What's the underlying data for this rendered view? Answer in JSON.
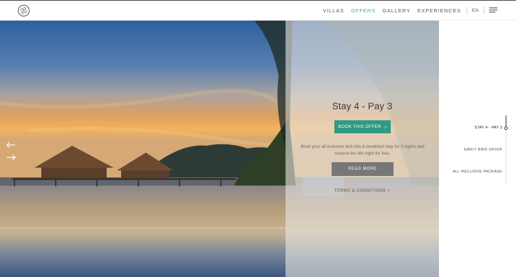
{
  "nav": {
    "items": [
      "VILLAS",
      "OFFERS",
      "GALLERY",
      "EXPERIENCES"
    ],
    "active": "OFFERS",
    "accent": "#3aa99a",
    "language": "EN",
    "logo_icon": "spiral-logo-icon",
    "menu_icon": "hamburger-menu-icon"
  },
  "hero": {
    "prev_icon": "arrow-left-icon",
    "next_icon": "arrow-right-icon"
  },
  "offer": {
    "title": "Stay 4 - Pay 3",
    "book_label": "BOOK THIS OFFER",
    "description": "Book your all-inclusive and villa & breakfast stay for 3 nights and receive the 4th night for free.",
    "read_more_label": "READ MORE",
    "terms_label": "TERMS & CONDITIONS +",
    "button_color": "#2e9b84"
  },
  "offer_list": {
    "items": [
      "STAY 4 - PAY 3",
      "EARLY BIRD OFFER",
      "ALL INCLUSIVE PACKAGE"
    ],
    "active_index": 0
  }
}
